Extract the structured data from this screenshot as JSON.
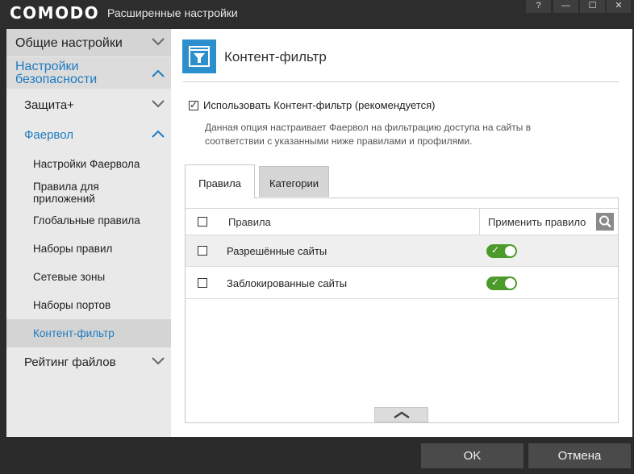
{
  "window": {
    "logo": "COMODO",
    "title": "Расширенные настройки",
    "help": "?",
    "minimize": "—",
    "maximize": "☐",
    "close": "✕"
  },
  "sidebar": {
    "general": "Общие настройки",
    "security": "Настройки безопасности",
    "protection": "Защита+",
    "firewall": "Фаервол",
    "firewall_items": [
      "Настройки Фаервола",
      "Правила для приложений",
      "Глобальные правила",
      "Наборы правил",
      "Сетевые зоны",
      "Наборы портов",
      "Контент-фильтр"
    ],
    "file_rating": "Рейтинг файлов"
  },
  "main": {
    "header_title": "Контент-фильтр",
    "use_filter_label": "Использовать Контент-фильтр (рекомендуется)",
    "use_filter_checked": true,
    "description": "Данная опция настраивает Фаервол на фильтрацию доступа на сайты в соответствии с указанными ниже правилами и профилями.",
    "tabs": [
      {
        "label": "Правила",
        "active": true
      },
      {
        "label": "Категории",
        "active": false
      }
    ],
    "table": {
      "col_rules": "Правила",
      "col_apply": "Применить правило",
      "rows": [
        {
          "label": "Разрешённые сайты",
          "enabled": true
        },
        {
          "label": "Заблокированные сайты",
          "enabled": true
        }
      ]
    }
  },
  "footer": {
    "ok": "OK",
    "cancel": "Отмена"
  },
  "colors": {
    "accent": "#1e7bc0",
    "toggle_on": "#4c9a2a",
    "icon_bg": "#2a8fcc"
  }
}
